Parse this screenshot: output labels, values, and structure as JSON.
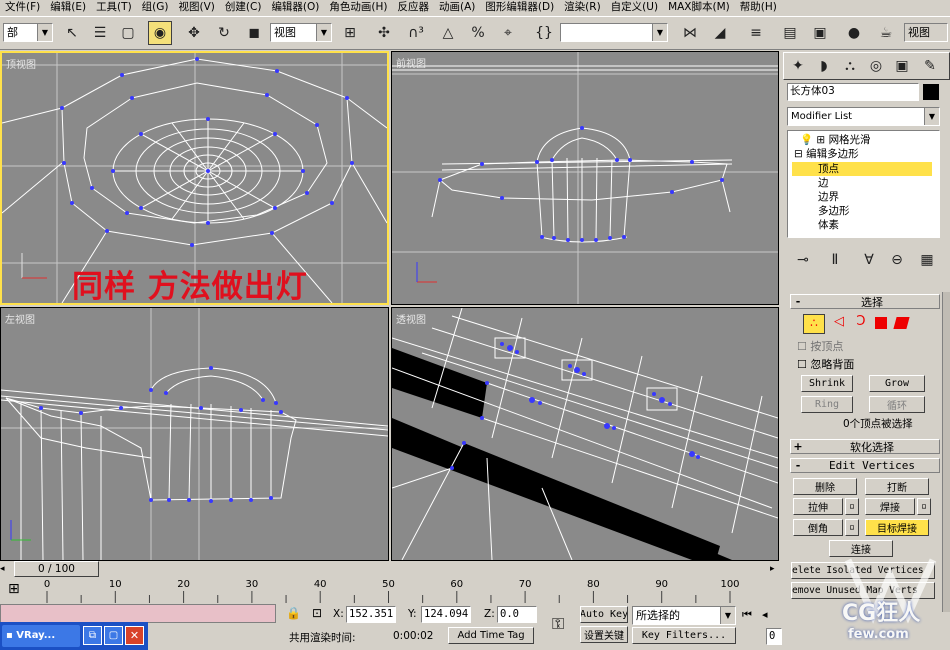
{
  "menu": [
    "文件(F)",
    "编辑(E)",
    "工具(T)",
    "组(G)",
    "视图(V)",
    "创建(C)",
    "编辑器(O)",
    "角色动画(H)",
    "反应器",
    "动画(A)",
    "图形编辑器(D)",
    "渲染(R)",
    "自定义(U)",
    "MAX脚本(M)",
    "帮助(H)"
  ],
  "toolbar": {
    "selection_filter": "部",
    "reference_coord": "视图",
    "named_selection": "",
    "view_right": "视图"
  },
  "viewports": {
    "top": "顶视图",
    "front": "前视图",
    "left": "左视图",
    "persp": "透视图",
    "annotation": "同样 方法做出灯"
  },
  "panel": {
    "object_name": "长方体03",
    "modifier_list": "Modifier List",
    "stack": [
      {
        "label": "网格光滑",
        "level": 0,
        "prefix": "⊞"
      },
      {
        "label": "编辑多边形",
        "level": 0,
        "prefix": "⊟"
      },
      {
        "label": "顶点",
        "level": 1,
        "selected": true
      },
      {
        "label": "边",
        "level": 1
      },
      {
        "label": "边界",
        "level": 1
      },
      {
        "label": "多边形",
        "level": 1
      },
      {
        "label": "体素",
        "level": 1
      }
    ],
    "rollout_select": "选择",
    "by_vertex": "按顶点",
    "ignore_backface": "忽略背面",
    "shrink": "Shrink",
    "grow": "Grow",
    "ring": "Ring",
    "loop": "循环",
    "sel_info": "0个顶点被选择",
    "rollout_soft": "软化选择",
    "rollout_edit": "Edit Vertices",
    "remove": "删除",
    "break": "打断",
    "extrude": "拉伸",
    "weld": "焊接",
    "chamfer": "倒角",
    "target_weld": "目标焊接",
    "connect": "连接",
    "remove_isolated": "elete Isolated Vertices",
    "remove_unused": "emove Unused Map Verts"
  },
  "timeline": {
    "frame": "0 / 100",
    "ticks": [
      "0",
      "10",
      "20",
      "30",
      "40",
      "50",
      "60",
      "70",
      "80",
      "90",
      "100"
    ]
  },
  "status": {
    "x_label": "X:",
    "x_val": "152.351",
    "y_label": "Y:",
    "y_val": "124.094",
    "z_label": "Z:",
    "z_val": "0.0",
    "render_time_label": "共用渲染时间:",
    "render_time": "0:00:02",
    "add_time_tag": "Add Time Tag",
    "auto_key": "Auto Key",
    "set_key": "设置关键",
    "sel_set": "所选择的",
    "key_filters": "Key Filters...",
    "frame_field": "0"
  },
  "taskbar": {
    "app": "VRay..."
  },
  "watermark": {
    "logo": "CG狂人",
    "site": "few.com"
  },
  "colors": {
    "accent": "#ffe14a",
    "viewport": "#8a8a8a",
    "vertex": "#3838ff",
    "annotation": "#e0101e"
  }
}
